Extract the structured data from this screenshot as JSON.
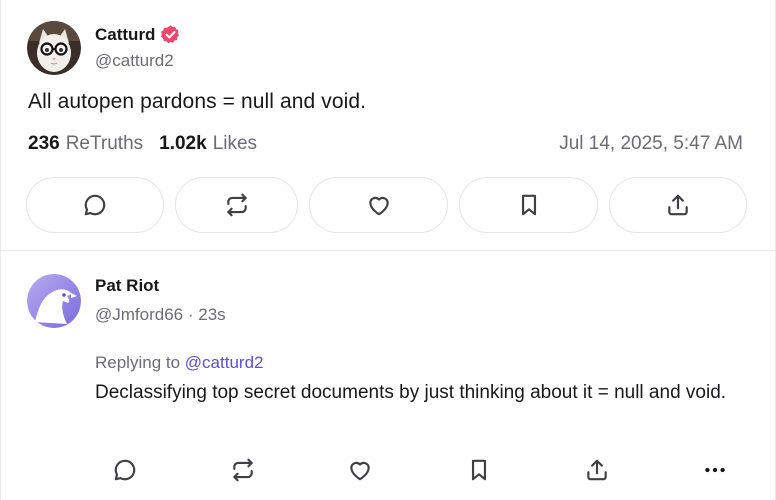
{
  "post": {
    "author": {
      "display_name": "Catturd",
      "handle": "@catturd2",
      "verified": true,
      "verified_color": "#f0476e",
      "avatar": "cat-with-glasses-avatar"
    },
    "text": "All autopen pardons = null and void.",
    "stats": {
      "retruths_count": "236",
      "retruths_label": "ReTruths",
      "likes_count": "1.02k",
      "likes_label": "Likes"
    },
    "timestamp": "Jul 14, 2025, 5:47 AM",
    "actions": [
      {
        "name": "reply",
        "icon": "comment-icon"
      },
      {
        "name": "retruth",
        "icon": "repost-icon"
      },
      {
        "name": "like",
        "icon": "heart-icon"
      },
      {
        "name": "bookmark",
        "icon": "bookmark-icon"
      },
      {
        "name": "share",
        "icon": "share-icon"
      }
    ]
  },
  "reply": {
    "author": {
      "display_name": "Pat Riot",
      "handle": "@Jmford66",
      "separator": "·",
      "time_ago": "23s",
      "avatar": "eagle-avatar"
    },
    "replying_to_label": "Replying to",
    "replying_to_handle": "@catturd2",
    "text": "Declassifying top secret documents by just thinking about it  = null and void.",
    "actions": [
      {
        "name": "reply",
        "icon": "comment-icon"
      },
      {
        "name": "retruth",
        "icon": "repost-icon"
      },
      {
        "name": "like",
        "icon": "heart-icon"
      },
      {
        "name": "bookmark",
        "icon": "bookmark-icon"
      },
      {
        "name": "share",
        "icon": "share-icon"
      },
      {
        "name": "more",
        "icon": "more-icon"
      }
    ]
  },
  "colors": {
    "text_primary": "#18181b",
    "text_secondary": "#6b6b76",
    "mention": "#5b4fd6",
    "border": "#e4e4e7",
    "icon": "#3f3f46"
  }
}
